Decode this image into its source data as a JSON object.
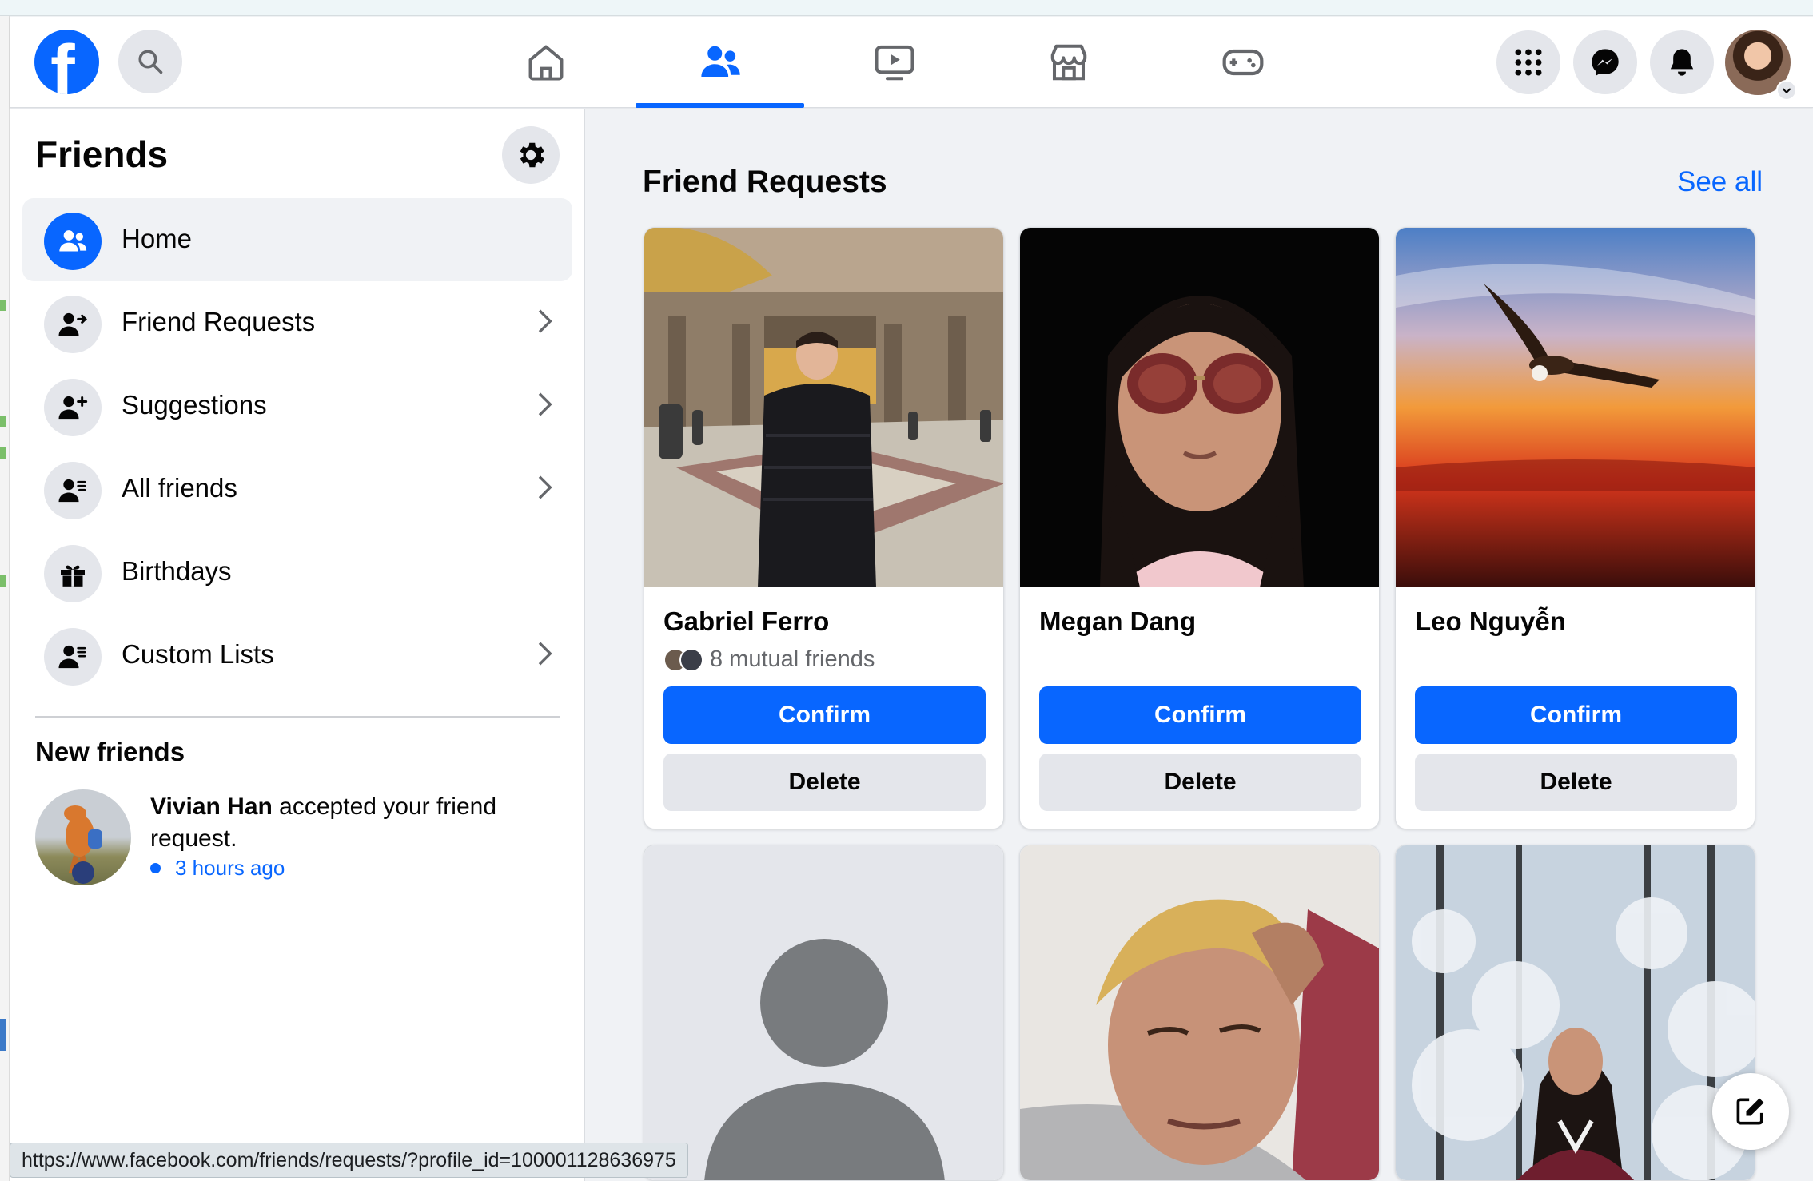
{
  "header": {
    "logo_letter": "f",
    "nav_tabs": [
      {
        "name": "home",
        "icon": "home-icon"
      },
      {
        "name": "friends",
        "icon": "friends-icon",
        "active": true
      },
      {
        "name": "watch",
        "icon": "video-icon"
      },
      {
        "name": "marketplace",
        "icon": "store-icon"
      },
      {
        "name": "gaming",
        "icon": "gamepad-icon"
      }
    ],
    "right_icons": [
      "menu-grid-icon",
      "messenger-icon",
      "bell-icon"
    ],
    "accent_color": "#0866ff"
  },
  "sidebar": {
    "title": "Friends",
    "items": [
      {
        "label": "Home",
        "icon": "friends-icon",
        "active": true,
        "chevron": false
      },
      {
        "label": "Friend Requests",
        "icon": "person-arrow-icon",
        "chevron": true
      },
      {
        "label": "Suggestions",
        "icon": "person-add-icon",
        "chevron": true
      },
      {
        "label": "All friends",
        "icon": "person-list-icon",
        "chevron": true
      },
      {
        "label": "Birthdays",
        "icon": "gift-icon",
        "chevron": false
      },
      {
        "label": "Custom Lists",
        "icon": "person-list-icon",
        "chevron": true
      }
    ],
    "new_friends": {
      "title": "New friends",
      "name": "Vivian Han",
      "text": " accepted your friend request.",
      "time": "3 hours ago"
    }
  },
  "main": {
    "title": "Friend Requests",
    "see_all": "See all",
    "cards": [
      {
        "name": "Gabriel Ferro",
        "mutual": "8 mutual friends",
        "confirm": "Confirm",
        "delete": "Delete"
      },
      {
        "name": "Megan Dang",
        "mutual": "",
        "confirm": "Confirm",
        "delete": "Delete"
      },
      {
        "name": "Leo Nguyễn",
        "mutual": "",
        "confirm": "Confirm",
        "delete": "Delete"
      }
    ]
  },
  "status_bar": {
    "url": "https://www.facebook.com/friends/requests/?profile_id=100001128636975"
  }
}
